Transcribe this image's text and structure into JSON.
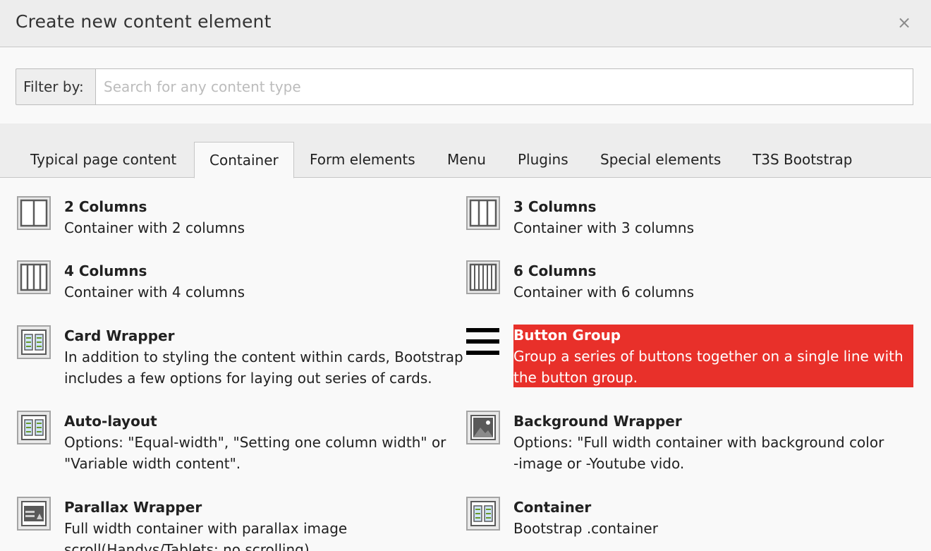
{
  "modal": {
    "title": "Create new content element",
    "close": "×"
  },
  "filter": {
    "label": "Filter by:",
    "placeholder": "Search for any content type",
    "value": ""
  },
  "tabs": [
    {
      "label": "Typical page content",
      "active": false
    },
    {
      "label": "Container",
      "active": true
    },
    {
      "label": "Form elements",
      "active": false
    },
    {
      "label": "Menu",
      "active": false
    },
    {
      "label": "Plugins",
      "active": false
    },
    {
      "label": "Special elements",
      "active": false
    },
    {
      "label": "T3S Bootstrap",
      "active": false
    }
  ],
  "items": [
    {
      "title": "2 Columns",
      "desc1": "Container with 2 columns",
      "icon": "two-columns-icon"
    },
    {
      "title": "3 Columns",
      "desc1": "Container with 3 columns",
      "icon": "three-columns-icon"
    },
    {
      "title": "4 Columns",
      "desc1": "Container with 4 columns",
      "icon": "four-columns-icon"
    },
    {
      "title": "6 Columns",
      "desc1": "Container with 6 columns",
      "icon": "six-columns-icon"
    },
    {
      "title": "Card Wrapper",
      "desc1": "In addition to styling the content within cards, Bootstrap",
      "desc2": "includes a few options for laying out series of cards.",
      "icon": "card-grid-icon"
    },
    {
      "title": "Button Group",
      "desc1": "Group a series of buttons together on a single line with",
      "desc2": "the button group.",
      "icon": "hamburger-icon",
      "highlighted": true
    },
    {
      "title": "Auto-layout",
      "desc1": "Options: \"Equal-width\", \"Setting one column width\" or",
      "desc2": "\"Variable width content\".",
      "icon": "card-grid-icon"
    },
    {
      "title": "Background Wrapper",
      "desc1": "Options: \"Full width container with background color",
      "desc2": "-image or -Youtube vido.",
      "icon": "image-icon"
    },
    {
      "title": "Parallax Wrapper",
      "desc1": "Full width container with parallax image",
      "desc2": "scroll(Handys/Tablets: no scrolling)",
      "icon": "parallax-icon"
    },
    {
      "title": "Container",
      "desc1": "Bootstrap .container",
      "icon": "card-grid-icon"
    }
  ],
  "colors": {
    "highlight": "#e8302a",
    "header_bg": "#ededed",
    "page_bg": "#f9f9f9"
  }
}
